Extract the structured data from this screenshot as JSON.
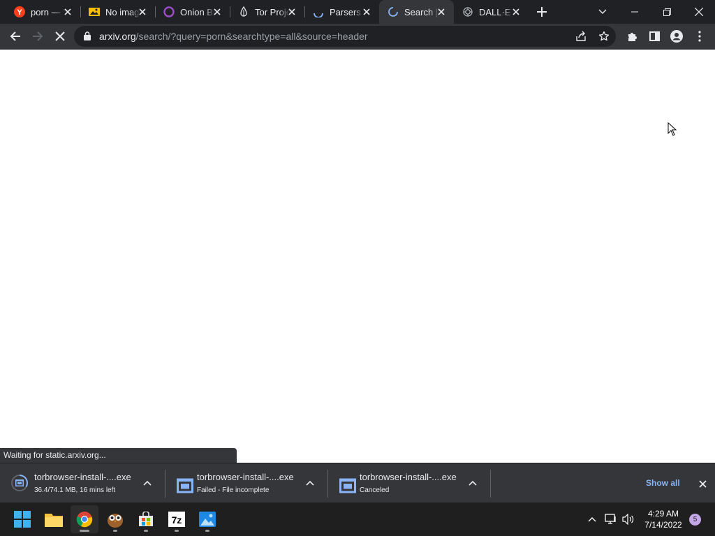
{
  "tabs": [
    {
      "title": "porn — Yandex",
      "icon": "yandex-icon"
    },
    {
      "title": "No image",
      "icon": "image-icon"
    },
    {
      "title": "Onion Browser",
      "icon": "onion-icon"
    },
    {
      "title": "Tor Project",
      "icon": "tor-icon"
    },
    {
      "title": "Parsers",
      "icon": "loading-icon"
    },
    {
      "title": "Search | arXiv",
      "icon": "loading-icon"
    },
    {
      "title": "DALL·E",
      "icon": "openai-icon"
    }
  ],
  "active_tab_index": 5,
  "address": {
    "host": "arxiv.org",
    "path": "/search/?query=porn&searchtype=all&source=header"
  },
  "status_text": "Waiting for static.arxiv.org...",
  "downloads": [
    {
      "name": "torbrowser-install-....exe",
      "status": "36.4/74.1 MB, 16 mins left",
      "in_progress": true
    },
    {
      "name": "torbrowser-install-....exe",
      "status": "Failed - File incomplete",
      "in_progress": false
    },
    {
      "name": "torbrowser-install-....exe",
      "status": "Canceled",
      "in_progress": false
    }
  ],
  "show_all_label": "Show all",
  "clock": {
    "time": "4:29 AM",
    "date": "7/14/2022"
  },
  "notification_count": "5",
  "colors": {
    "tabstrip": "#202124",
    "toolbar": "#35363a",
    "accent": "#8ab4f8",
    "taskbar": "#1f1f1f"
  }
}
